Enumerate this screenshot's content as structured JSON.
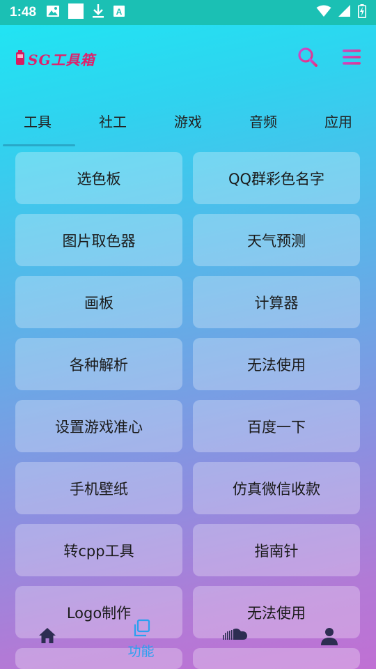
{
  "status_bar": {
    "time": "1:48",
    "left_icons": [
      "image-icon",
      "square-icon",
      "download-icon",
      "font-icon"
    ],
    "right_icons": [
      "wifi-icon",
      "signal-icon",
      "battery-icon"
    ]
  },
  "header": {
    "app_name": "SG工具箱",
    "search_icon": "search-icon",
    "menu_icon": "menu-icon",
    "accent": "#e0206a"
  },
  "tabs": [
    {
      "label": "工具",
      "active": true
    },
    {
      "label": "社工",
      "active": false
    },
    {
      "label": "游戏",
      "active": false
    },
    {
      "label": "音频",
      "active": false
    },
    {
      "label": "应用",
      "active": false
    }
  ],
  "tools": [
    "选色板",
    "QQ群彩色名字",
    "图片取色器",
    "天气预测",
    "画板",
    "计算器",
    "各种解析",
    "无法使用",
    "设置游戏准心",
    "百度一下",
    "手机壁纸",
    "仿真微信收款",
    "转cpp工具",
    "指南针",
    "Logo制作",
    "无法使用",
    "",
    ""
  ],
  "bottom_nav": [
    {
      "icon": "home-icon",
      "label": "",
      "active": false
    },
    {
      "icon": "function-icon",
      "label": "功能",
      "active": true
    },
    {
      "icon": "soundcloud-icon",
      "label": "",
      "active": false
    },
    {
      "icon": "person-icon",
      "label": "",
      "active": false
    }
  ],
  "colors": {
    "status_bar": "#1bc0b4",
    "active_nav": "#2aa0f0",
    "tab_indicator": "#29a8c8",
    "icon_dark": "#2d2d52"
  }
}
